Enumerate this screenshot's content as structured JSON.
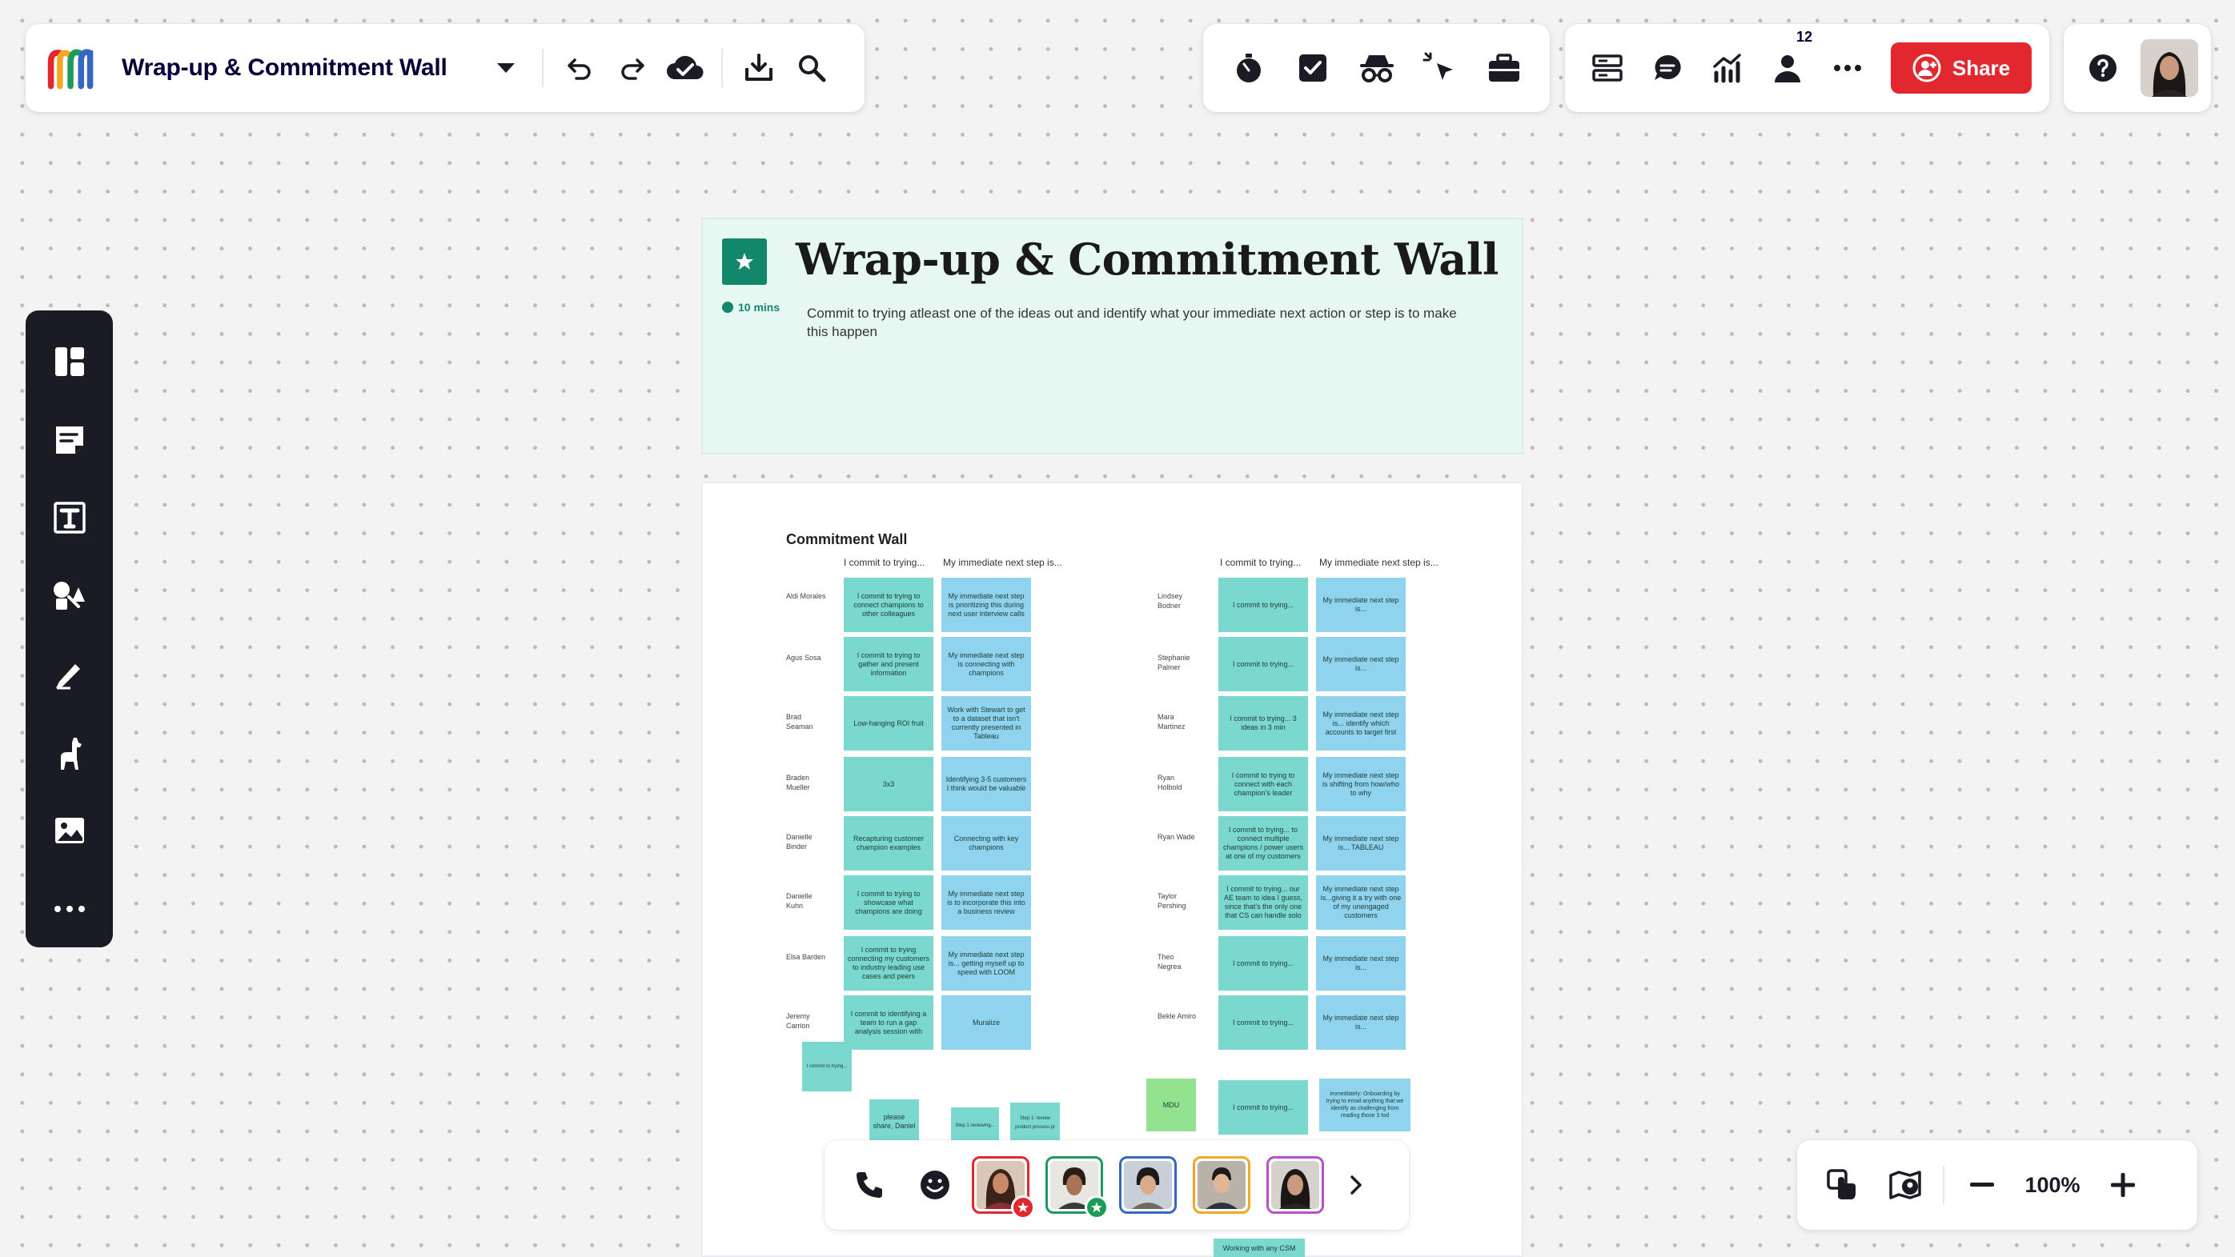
{
  "toolbar": {
    "board_title": "Wrap-up & Commitment Wall",
    "icons": [
      "board-menu-caret",
      "undo-icon",
      "redo-icon",
      "cloud-saved-icon",
      "export-icon",
      "search-icon"
    ]
  },
  "collab_tools": {
    "icons": [
      "timer-icon",
      "voting-icon",
      "private-mode-icon",
      "attention-management-icon",
      "toolkit-icon"
    ]
  },
  "header_actions": {
    "icons": [
      "cards-icon",
      "comments-icon",
      "activity-icon",
      "collaborators-icon",
      "more-icon"
    ],
    "collaborator_count": "12",
    "share_label": "Share"
  },
  "help": {
    "icon": "help-icon"
  },
  "sidebar": {
    "items": [
      "templates",
      "sticky-note",
      "text",
      "shapes",
      "pen",
      "llama",
      "image",
      "more"
    ]
  },
  "frame_header": {
    "title": "Wrap-up & Commitment Wall",
    "timer_label": "10 mins",
    "description": "Commit to trying atleast one of the ideas out and identify what your immediate next action or step is to make this happen"
  },
  "wall": {
    "title": "Commitment Wall",
    "col1_header": "I commit to trying...",
    "col2_header": "My immediate next step is...",
    "left_rows": [
      {
        "name": "Aldi Morales",
        "commit": "I commit to trying to connect champions to other colleagues",
        "next": "My immediate next step is prioritizing this during next user interview calls"
      },
      {
        "name": "Agus Sosa",
        "commit": "I commit to trying to gather and present information",
        "next": "My immediate next step is connecting with champions"
      },
      {
        "name": "Brad Seaman",
        "commit": "Low-hanging ROI fruit",
        "next": "Work with Stewart to get to a dataset that isn't currently presented in Tableau"
      },
      {
        "name": "Braden Mueller",
        "commit": "3x3",
        "next": "Identifying 3-5 customers I think would be valuable"
      },
      {
        "name": "Danielle Binder",
        "commit": "Recapturing customer champion examples",
        "next": "Connecting with key champions"
      },
      {
        "name": "Danielle Kuhn",
        "commit": "I commit to trying to showcase what champions are doing",
        "next": "My immediate next step is to incorporate this into a business review"
      },
      {
        "name": "Elsa Barden",
        "commit": "I commit to trying connecting my customers to industry leading use cases and peers",
        "next": "My immediate next step is... getting myself up to speed with LOOM"
      },
      {
        "name": "Jeremy Carrion",
        "commit": "I commit to identifying a team to run a gap analysis session with",
        "next": "Muralize"
      }
    ],
    "right_rows": [
      {
        "name": "Lindsey Bodner",
        "commit": "I commit to trying...",
        "next": "My immediate next step is..."
      },
      {
        "name": "Stephanie Palmer",
        "commit": "I commit to trying...",
        "next": "My immediate next step is..."
      },
      {
        "name": "Mara Martinez",
        "commit": "I commit to trying... 3 ideas in 3 min",
        "next": "My immediate next step is... identify which accounts to target first"
      },
      {
        "name": "Ryan Holbold",
        "commit": "I commit to trying to connect with each champion's leader",
        "next": "My immediate next step is shifting from how/who to why"
      },
      {
        "name": "Ryan Wade",
        "commit": "I commit to trying... to connect multiple champions / power users at one of my customers",
        "next": "My immediate next step is... TABLEAU"
      },
      {
        "name": "Taylor Pershing",
        "commit": "I commit to trying... our AE team to idea I guess, since that's the only one that CS can handle solo",
        "next": "My immediate next step is...giving it a try with one of my unengaged customers"
      },
      {
        "name": "Theo Negrea",
        "commit": "I commit to trying...",
        "next": "My immediate next step is..."
      },
      {
        "name": "Bekle Amiro",
        "commit": "I commit to trying...",
        "next": "My immediate next step is..."
      }
    ],
    "extras": {
      "loose_note": "I commit to trying...",
      "please_share": "please share, Daniel",
      "note_a": "Step 1 reviewing...",
      "note_b": "Step 1: review product process pr",
      "mdu": "MDU",
      "extra_commit": "I commit to trying...",
      "extra_next": "Immediately: Onboarding by trying to email anything that we identify as challenging from reading those 3 tod",
      "working_with": "Working with any CSM"
    }
  },
  "collab_bar": {
    "icons": [
      "phone-icon",
      "reactions-icon",
      "expand-icon"
    ],
    "participants": [
      {
        "name": "participant-1",
        "ring": "#e2272e",
        "badge": "star"
      },
      {
        "name": "participant-2",
        "ring": "#1e9b5a",
        "badge": "star"
      },
      {
        "name": "participant-3",
        "ring": "#3567c9",
        "badge": ""
      },
      {
        "name": "participant-4",
        "ring": "#f2a824",
        "badge": ""
      },
      {
        "name": "participant-5",
        "ring": "#b552c9",
        "badge": ""
      }
    ]
  },
  "zoom": {
    "level": "100%",
    "icons": [
      "gesture-icon",
      "map-icon",
      "zoom-out-icon",
      "zoom-in-icon"
    ]
  },
  "colors": {
    "accent_red": "#e2272e",
    "frame_mint": "#e6f8f1",
    "sticky_teal": "#7ad8cf",
    "sticky_blue": "#8fd3ee"
  }
}
